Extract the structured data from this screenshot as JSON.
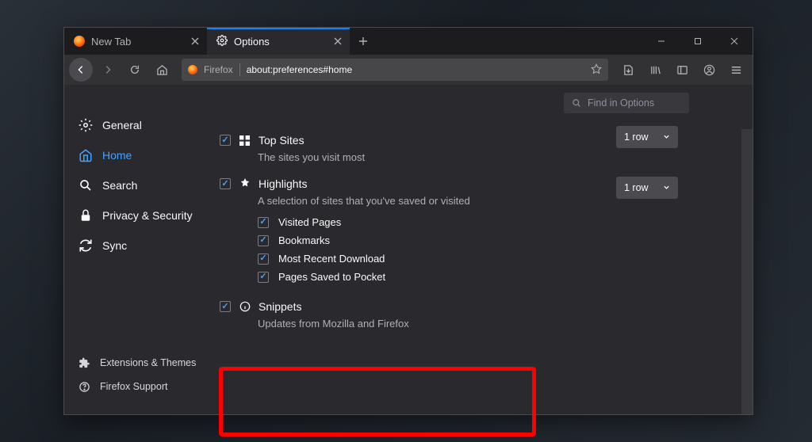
{
  "tabs": {
    "inactive": {
      "label": "New Tab"
    },
    "active": {
      "label": "Options"
    }
  },
  "urlbar": {
    "prefix": "Firefox",
    "path": "about:preferences#home"
  },
  "search": {
    "placeholder": "Find in Options"
  },
  "sidebar": {
    "items": [
      {
        "label": "General"
      },
      {
        "label": "Home"
      },
      {
        "label": "Search"
      },
      {
        "label": "Privacy & Security"
      },
      {
        "label": "Sync"
      }
    ],
    "footer": [
      {
        "label": "Extensions & Themes"
      },
      {
        "label": "Firefox Support"
      }
    ]
  },
  "sections": {
    "topsites": {
      "title": "Top Sites",
      "desc": "The sites you visit most",
      "dropdown": "1 row"
    },
    "highlights": {
      "title": "Highlights",
      "desc": "A selection of sites that you've saved or visited",
      "dropdown": "1 row",
      "items": [
        {
          "label": "Visited Pages"
        },
        {
          "label": "Bookmarks"
        },
        {
          "label": "Most Recent Download"
        },
        {
          "label": "Pages Saved to Pocket"
        }
      ]
    },
    "snippets": {
      "title": "Snippets",
      "desc": "Updates from Mozilla and Firefox"
    }
  }
}
